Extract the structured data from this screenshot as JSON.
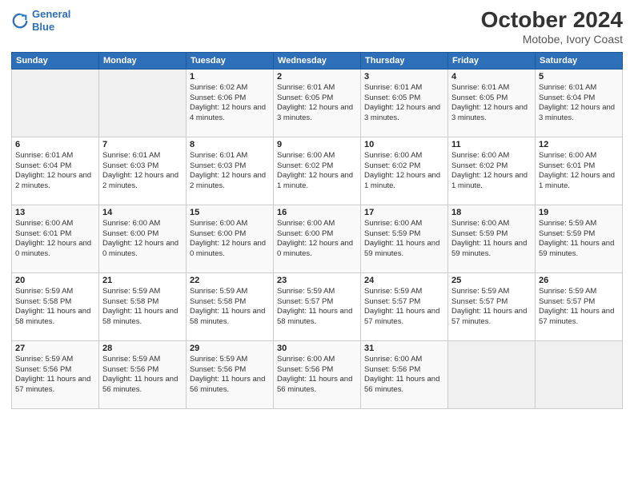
{
  "logo": {
    "line1": "General",
    "line2": "Blue"
  },
  "title": "October 2024",
  "subtitle": "Motobe, Ivory Coast",
  "days_of_week": [
    "Sunday",
    "Monday",
    "Tuesday",
    "Wednesday",
    "Thursday",
    "Friday",
    "Saturday"
  ],
  "weeks": [
    [
      {
        "day": "",
        "info": ""
      },
      {
        "day": "",
        "info": ""
      },
      {
        "day": "1",
        "info": "Sunrise: 6:02 AM\nSunset: 6:06 PM\nDaylight: 12 hours and 4 minutes."
      },
      {
        "day": "2",
        "info": "Sunrise: 6:01 AM\nSunset: 6:05 PM\nDaylight: 12 hours and 3 minutes."
      },
      {
        "day": "3",
        "info": "Sunrise: 6:01 AM\nSunset: 6:05 PM\nDaylight: 12 hours and 3 minutes."
      },
      {
        "day": "4",
        "info": "Sunrise: 6:01 AM\nSunset: 6:05 PM\nDaylight: 12 hours and 3 minutes."
      },
      {
        "day": "5",
        "info": "Sunrise: 6:01 AM\nSunset: 6:04 PM\nDaylight: 12 hours and 3 minutes."
      }
    ],
    [
      {
        "day": "6",
        "info": "Sunrise: 6:01 AM\nSunset: 6:04 PM\nDaylight: 12 hours and 2 minutes."
      },
      {
        "day": "7",
        "info": "Sunrise: 6:01 AM\nSunset: 6:03 PM\nDaylight: 12 hours and 2 minutes."
      },
      {
        "day": "8",
        "info": "Sunrise: 6:01 AM\nSunset: 6:03 PM\nDaylight: 12 hours and 2 minutes."
      },
      {
        "day": "9",
        "info": "Sunrise: 6:00 AM\nSunset: 6:02 PM\nDaylight: 12 hours and 1 minute."
      },
      {
        "day": "10",
        "info": "Sunrise: 6:00 AM\nSunset: 6:02 PM\nDaylight: 12 hours and 1 minute."
      },
      {
        "day": "11",
        "info": "Sunrise: 6:00 AM\nSunset: 6:02 PM\nDaylight: 12 hours and 1 minute."
      },
      {
        "day": "12",
        "info": "Sunrise: 6:00 AM\nSunset: 6:01 PM\nDaylight: 12 hours and 1 minute."
      }
    ],
    [
      {
        "day": "13",
        "info": "Sunrise: 6:00 AM\nSunset: 6:01 PM\nDaylight: 12 hours and 0 minutes."
      },
      {
        "day": "14",
        "info": "Sunrise: 6:00 AM\nSunset: 6:00 PM\nDaylight: 12 hours and 0 minutes."
      },
      {
        "day": "15",
        "info": "Sunrise: 6:00 AM\nSunset: 6:00 PM\nDaylight: 12 hours and 0 minutes."
      },
      {
        "day": "16",
        "info": "Sunrise: 6:00 AM\nSunset: 6:00 PM\nDaylight: 12 hours and 0 minutes."
      },
      {
        "day": "17",
        "info": "Sunrise: 6:00 AM\nSunset: 5:59 PM\nDaylight: 11 hours and 59 minutes."
      },
      {
        "day": "18",
        "info": "Sunrise: 6:00 AM\nSunset: 5:59 PM\nDaylight: 11 hours and 59 minutes."
      },
      {
        "day": "19",
        "info": "Sunrise: 5:59 AM\nSunset: 5:59 PM\nDaylight: 11 hours and 59 minutes."
      }
    ],
    [
      {
        "day": "20",
        "info": "Sunrise: 5:59 AM\nSunset: 5:58 PM\nDaylight: 11 hours and 58 minutes."
      },
      {
        "day": "21",
        "info": "Sunrise: 5:59 AM\nSunset: 5:58 PM\nDaylight: 11 hours and 58 minutes."
      },
      {
        "day": "22",
        "info": "Sunrise: 5:59 AM\nSunset: 5:58 PM\nDaylight: 11 hours and 58 minutes."
      },
      {
        "day": "23",
        "info": "Sunrise: 5:59 AM\nSunset: 5:57 PM\nDaylight: 11 hours and 58 minutes."
      },
      {
        "day": "24",
        "info": "Sunrise: 5:59 AM\nSunset: 5:57 PM\nDaylight: 11 hours and 57 minutes."
      },
      {
        "day": "25",
        "info": "Sunrise: 5:59 AM\nSunset: 5:57 PM\nDaylight: 11 hours and 57 minutes."
      },
      {
        "day": "26",
        "info": "Sunrise: 5:59 AM\nSunset: 5:57 PM\nDaylight: 11 hours and 57 minutes."
      }
    ],
    [
      {
        "day": "27",
        "info": "Sunrise: 5:59 AM\nSunset: 5:56 PM\nDaylight: 11 hours and 57 minutes."
      },
      {
        "day": "28",
        "info": "Sunrise: 5:59 AM\nSunset: 5:56 PM\nDaylight: 11 hours and 56 minutes."
      },
      {
        "day": "29",
        "info": "Sunrise: 5:59 AM\nSunset: 5:56 PM\nDaylight: 11 hours and 56 minutes."
      },
      {
        "day": "30",
        "info": "Sunrise: 6:00 AM\nSunset: 5:56 PM\nDaylight: 11 hours and 56 minutes."
      },
      {
        "day": "31",
        "info": "Sunrise: 6:00 AM\nSunset: 5:56 PM\nDaylight: 11 hours and 56 minutes."
      },
      {
        "day": "",
        "info": ""
      },
      {
        "day": "",
        "info": ""
      }
    ]
  ]
}
